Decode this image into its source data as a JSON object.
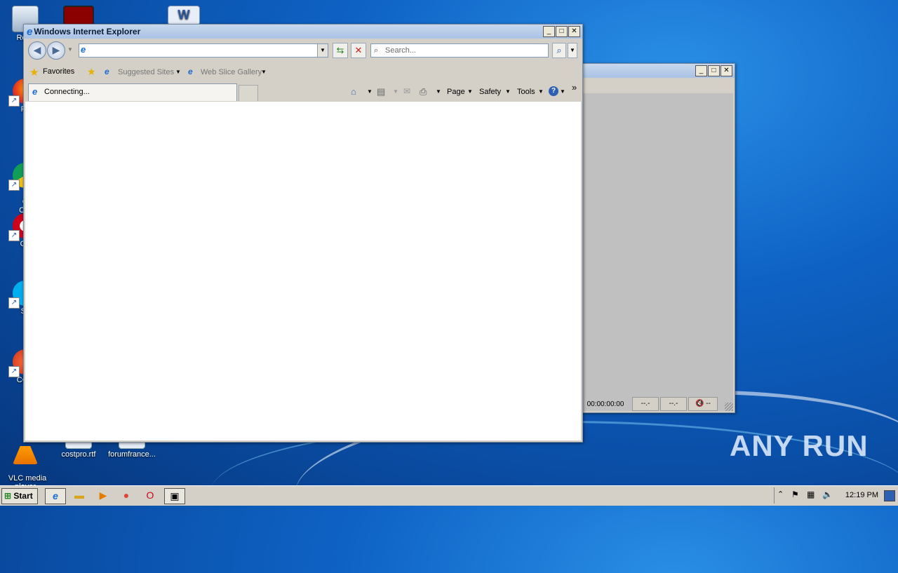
{
  "desktop": {
    "icons": [
      {
        "label": "Recy"
      },
      {
        "label": "Fir"
      },
      {
        "label": "Go\nChr"
      },
      {
        "label": "Op"
      },
      {
        "label": "Sk"
      },
      {
        "label": "CCle"
      },
      {
        "label": "VLC media\nplayer"
      },
      {
        "label": "costpro.rtf"
      },
      {
        "label": "forumfrance..."
      }
    ]
  },
  "ie": {
    "title": "Windows Internet Explorer",
    "address_value": "",
    "search_placeholder": "Search...",
    "favorites_label": "Favorites",
    "suggested_sites_label": "Suggested Sites",
    "web_slice_label": "Web Slice Gallery",
    "tab_label": "Connecting...",
    "toolbar": {
      "page_label": "Page",
      "safety_label": "Safety",
      "tools_label": "Tools"
    }
  },
  "media": {
    "time": "00:00:00:00",
    "field1": "--.-",
    "field2": "--.-",
    "field3": "--"
  },
  "taskbar": {
    "start_label": "Start",
    "clock": "12:19 PM"
  },
  "watermark": "ANY RUN"
}
